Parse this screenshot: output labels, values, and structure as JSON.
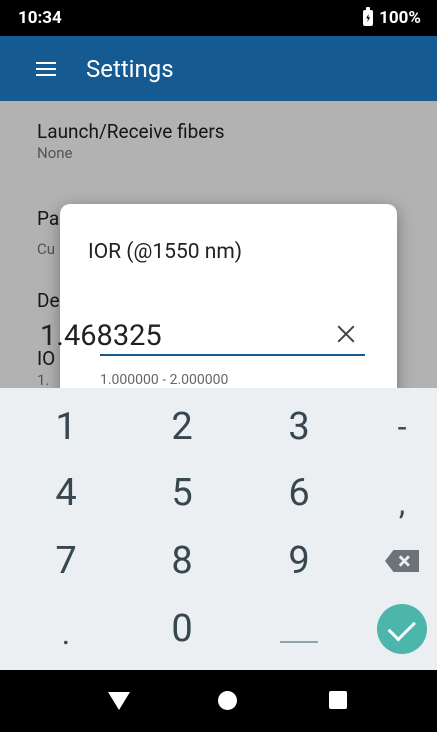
{
  "status_bar": {
    "time": "10:34",
    "battery": "100%"
  },
  "app_bar": {
    "title": "Settings"
  },
  "settings": [
    {
      "title": "Launch/Receive fibers",
      "subtitle": "None"
    },
    {
      "title": "Pa",
      "subtitle": "Cu"
    },
    {
      "title": "De",
      "subtitle": ""
    },
    {
      "title": "IO",
      "subtitle": "1."
    }
  ],
  "dialog": {
    "title": "IOR (@1550 nm)",
    "value": "1.468325",
    "hint": "1.000000 - 2.000000"
  },
  "keyboard": {
    "keys": [
      "1",
      "2",
      "3",
      "-",
      "4",
      "5",
      "6",
      ",",
      "7",
      "8",
      "9",
      ".",
      "0"
    ]
  },
  "colors": {
    "app_bar": "#155a91",
    "accent": "#155a91",
    "done": "#4db6ac"
  }
}
